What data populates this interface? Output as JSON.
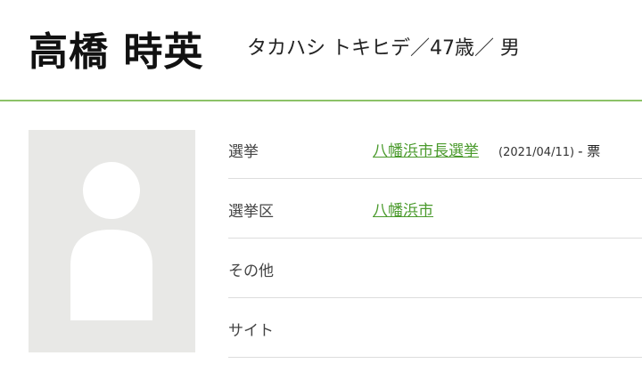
{
  "header": {
    "name": "高橋 時英",
    "meta": "タカハシ トキヒデ／47歳／ 男"
  },
  "photo": {
    "icon": "avatar-placeholder-icon"
  },
  "rows": [
    {
      "label": "選挙",
      "link": "八幡浜市長選挙",
      "date": "(2021/04/11)",
      "votes": "- 票"
    },
    {
      "label": "選挙区",
      "link": "八幡浜市"
    },
    {
      "label": "その他"
    },
    {
      "label": "サイト"
    }
  ],
  "colors": {
    "accent": "#8cc267",
    "link": "#4a9a2c",
    "placeholder_bg": "#e8e8e6",
    "placeholder_fg": "#ffffff"
  }
}
